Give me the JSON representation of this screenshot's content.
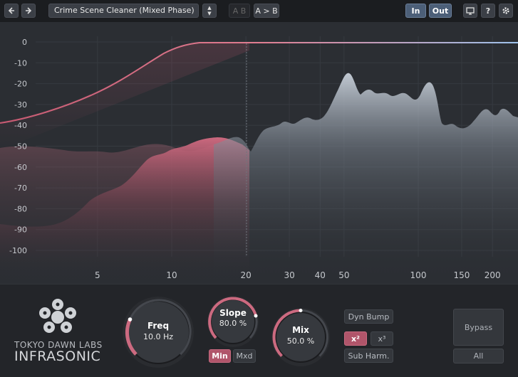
{
  "toolbar": {
    "back_icon": "arrow-left-icon",
    "forward_icon": "arrow-right-icon",
    "preset_name": "Crime Scene Cleaner (Mixed Phase)",
    "ab_label": "A B",
    "a_to_b_label": "A > B",
    "in_label": "In",
    "out_label": "Out",
    "display_icon": "monitor-icon",
    "help_label": "?",
    "settings_icon": "gear-icon"
  },
  "graph": {
    "y_ticks": [
      "0",
      "-10",
      "-20",
      "-30",
      "-40",
      "-50",
      "-60",
      "-70",
      "-80",
      "-90",
      "-100"
    ],
    "x_ticks": [
      "5",
      "10",
      "20",
      "30",
      "40",
      "50",
      "100",
      "150",
      "200"
    ],
    "colors": {
      "filter_curve": "#d9667f",
      "flat_line": "#8fb4e0",
      "spectrum": "#b8c1cc",
      "spectrum_filtered": "#b5536a"
    }
  },
  "logo": {
    "line1": "Tokyo Dawn Labs",
    "line2": "INFRASONIC"
  },
  "controls": {
    "freq": {
      "label": "Freq",
      "value": "10.0 Hz"
    },
    "slope": {
      "label": "Slope",
      "value": "80.0 %",
      "level": 0.8
    },
    "mix": {
      "label": "Mix",
      "value": "50.0 %",
      "level": 0.5
    },
    "min_label": "Min",
    "mxd_label": "Mxd",
    "dyn_bump_label": "Dyn Bump",
    "x2_label": "x²",
    "x3_label": "x³",
    "sub_harm_label": "Sub Harm.",
    "bypass_label": "Bypass",
    "all_label": "All"
  }
}
